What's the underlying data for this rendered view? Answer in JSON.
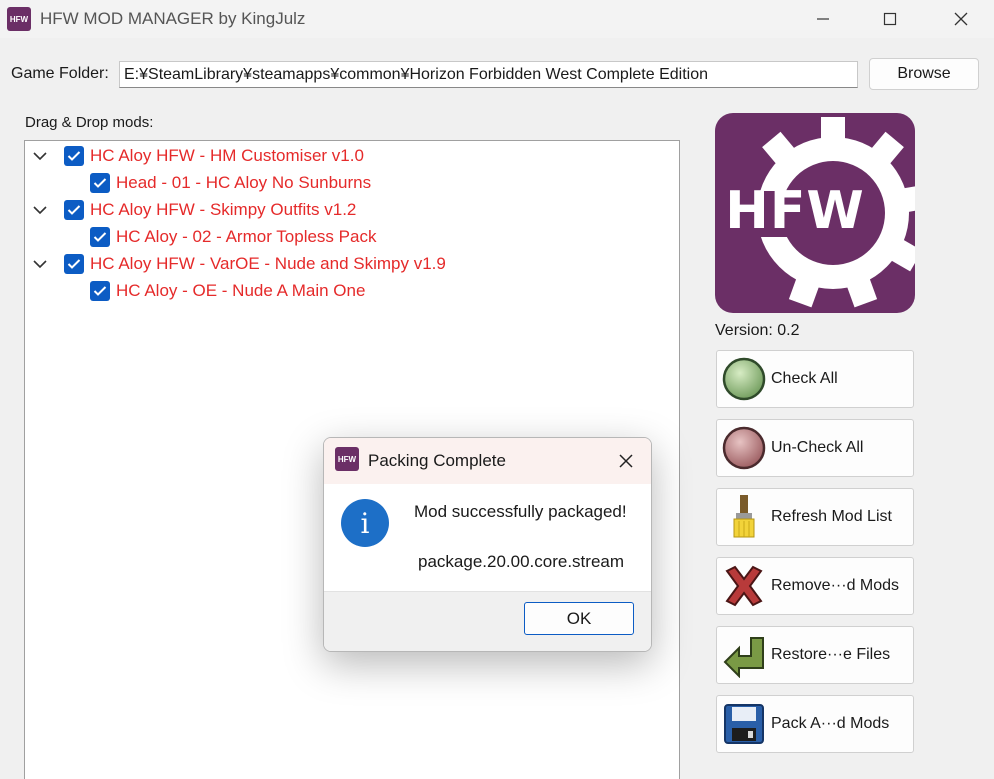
{
  "window": {
    "icon_text": "HFW",
    "title": "HFW MOD MANAGER by KingJulz"
  },
  "folder": {
    "label": "Game Folder:",
    "value": "E:¥SteamLibrary¥steamapps¥common¥Horizon Forbidden West Complete Edition",
    "browse_label": "Browse"
  },
  "mods": {
    "label": "Drag & Drop mods:",
    "items": [
      {
        "label": "HC Aloy HFW - HM Customiser v1.0",
        "level": 0,
        "checked": true
      },
      {
        "label": "Head - 01 - HC Aloy No Sunburns",
        "level": 1,
        "checked": true
      },
      {
        "label": "HC Aloy HFW - Skimpy Outfits v1.2",
        "level": 0,
        "checked": true
      },
      {
        "label": "HC Aloy - 02 - Armor Topless Pack",
        "level": 1,
        "checked": true
      },
      {
        "label": "HC Aloy HFW - VarOE - Nude and Skimpy v1.9",
        "level": 0,
        "checked": true
      },
      {
        "label": "HC Aloy - OE - Nude A Main One",
        "level": 1,
        "checked": true
      }
    ]
  },
  "logo": {
    "text": "HFW"
  },
  "version": "Version: 0.2",
  "buttons": {
    "check_all": "Check All",
    "uncheck_all": "Un-Check All",
    "refresh": "Refresh Mod List",
    "remove": "Remove···d Mods",
    "restore": "Restore···e Files",
    "pack": "Pack A···d Mods"
  },
  "dialog": {
    "icon_text": "HFW",
    "title": "Packing Complete",
    "message": "Mod successfully packaged!",
    "filename": "package.20.00.core.stream",
    "ok_label": "OK"
  },
  "colors": {
    "brand_purple": "#6b2f66",
    "mod_text_red": "#e52a2a",
    "checkbox_blue": "#0c5cc4",
    "info_blue": "#1d6fc7"
  }
}
